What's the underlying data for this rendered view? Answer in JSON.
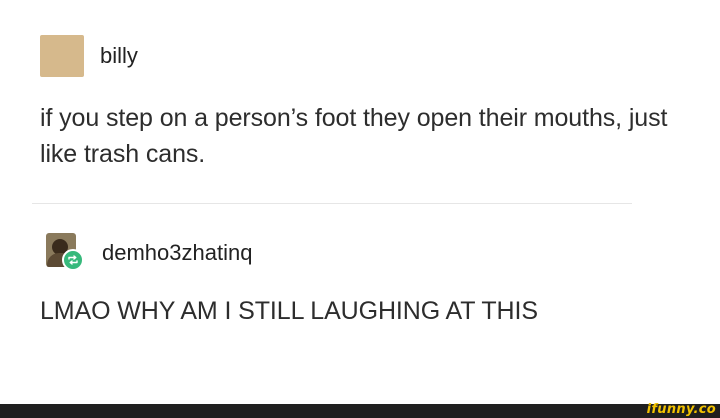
{
  "posts": [
    {
      "username": "billy",
      "text": "if you step on a person’s foot they open their mouths, just like trash cans."
    },
    {
      "username": "demho3zhatinq",
      "text": "LMAO WHY AM I STILL LAUGHING AT THIS"
    }
  ],
  "watermark": "ifunny.co",
  "colors": {
    "avatar_square": "#d6b98c",
    "reblog_badge": "#37b97c",
    "footer_bar": "#1f1f1f",
    "watermark": "#f2c200"
  },
  "icons": [
    "reblog-icon"
  ]
}
